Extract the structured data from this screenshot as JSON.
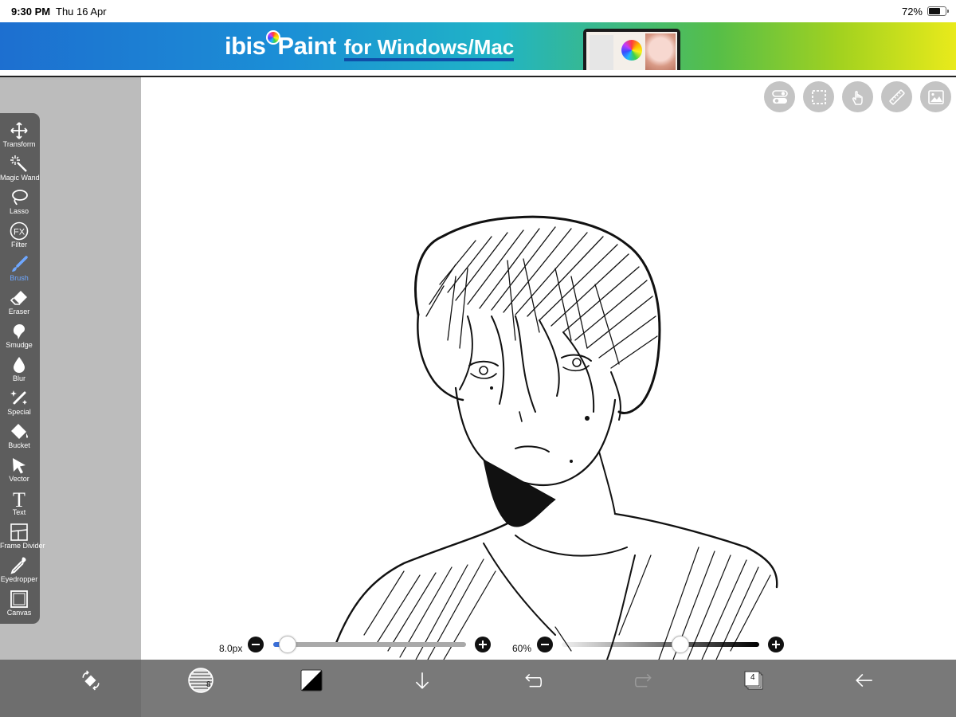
{
  "status_bar": {
    "time": "9:30 PM",
    "date": "Thu 16 Apr",
    "battery_percent": "72%",
    "battery_level": 0.72
  },
  "banner": {
    "logo_text": "ibis",
    "logo_text_end": "aint",
    "subtitle": "for Windows/Mac"
  },
  "top_buttons": [
    {
      "name": "toggle-settings",
      "icon": "toggle-icon"
    },
    {
      "name": "selection",
      "icon": "dashed-square-icon"
    },
    {
      "name": "touch-gesture",
      "icon": "hand-touch-icon"
    },
    {
      "name": "ruler",
      "icon": "ruler-icon"
    },
    {
      "name": "material",
      "icon": "image-icon"
    }
  ],
  "tools": [
    {
      "label": "Transform",
      "icon": "move-arrows-icon",
      "active": false
    },
    {
      "label": "Magic Wand",
      "icon": "magic-wand-icon",
      "active": false
    },
    {
      "label": "Lasso",
      "icon": "lasso-icon",
      "active": false
    },
    {
      "label": "Filter",
      "icon": "fx-icon",
      "active": false
    },
    {
      "label": "Brush",
      "icon": "brush-icon",
      "active": true
    },
    {
      "label": "Eraser",
      "icon": "eraser-icon",
      "active": false
    },
    {
      "label": "Smudge",
      "icon": "smudge-icon",
      "active": false
    },
    {
      "label": "Blur",
      "icon": "drop-icon",
      "active": false
    },
    {
      "label": "Special",
      "icon": "sparkle-pen-icon",
      "active": false
    },
    {
      "label": "Bucket",
      "icon": "bucket-icon",
      "active": false
    },
    {
      "label": "Vector",
      "icon": "cursor-arrow-icon",
      "active": false
    },
    {
      "label": "Text",
      "icon": "text-t-icon",
      "active": false
    },
    {
      "label": "Frame Divider",
      "icon": "frame-divider-icon",
      "active": false
    },
    {
      "label": "Eyedropper",
      "icon": "eyedropper-icon",
      "active": false
    },
    {
      "label": "Canvas",
      "icon": "canvas-icon",
      "active": false
    }
  ],
  "brush_size": {
    "value_text": "8.0px",
    "level": 0.02
  },
  "opacity": {
    "value_text": "60%",
    "level": 0.6
  },
  "bottom_bar": {
    "brush_preview_number": "8",
    "layers_count": "4",
    "buttons": [
      "transform-pen-icon",
      "brush-preview-icon",
      "color-swatch-icon",
      "down-arrow-icon",
      "undo-icon",
      "redo-icon",
      "layers-icon",
      "back-arrow-icon"
    ]
  },
  "colors": {
    "toolbar_bg": "#5d5d5d",
    "active_tool": "#6ea7ff",
    "slider_blue": "#3a6fd8",
    "bottom_bar": "#6e6e6e"
  }
}
